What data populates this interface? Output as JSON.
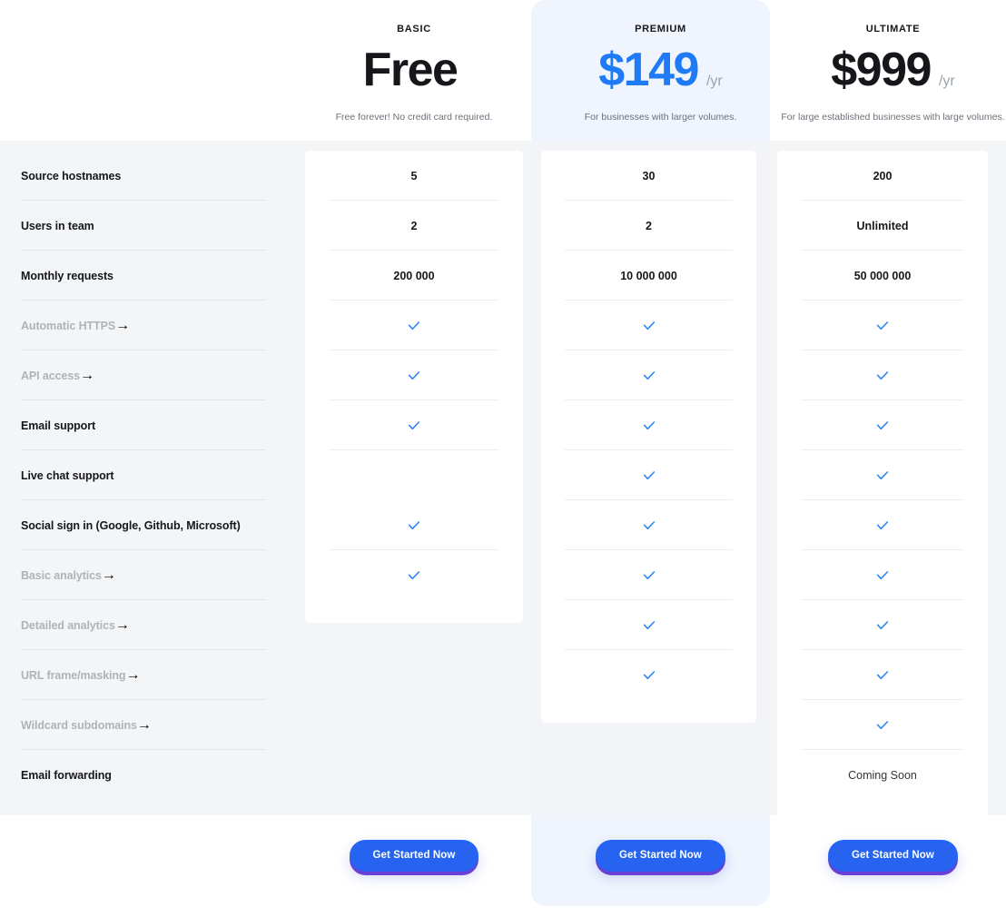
{
  "plans": [
    {
      "id": "basic",
      "name": "BASIC",
      "price": "Free",
      "period": "",
      "description": "Free forever! No credit card required.",
      "cta": "Get Started Now",
      "accent": false
    },
    {
      "id": "premium",
      "name": "PREMIUM",
      "price": "$149",
      "period": "/yr",
      "description": "For businesses with larger volumes.",
      "cta": "Get Started Now",
      "accent": true
    },
    {
      "id": "ultimate",
      "name": "ULTIMATE",
      "price": "$999",
      "period": "/yr",
      "description": "For large established businesses with large volumes.",
      "cta": "Get Started Now",
      "accent": false
    }
  ],
  "features": [
    {
      "label": "Source hostnames",
      "muted": false,
      "link": false,
      "basic": "5",
      "premium": "30",
      "ultimate": "200"
    },
    {
      "label": "Users in team",
      "muted": false,
      "link": false,
      "basic": "2",
      "premium": "2",
      "ultimate": "Unlimited"
    },
    {
      "label": "Monthly requests",
      "muted": false,
      "link": false,
      "basic": "200 000",
      "premium": "10 000 000",
      "ultimate": "50 000 000"
    },
    {
      "label": "Automatic HTTPS",
      "muted": true,
      "link": true,
      "basic": "check",
      "premium": "check",
      "ultimate": "check"
    },
    {
      "label": "API access",
      "muted": true,
      "link": true,
      "basic": "check",
      "premium": "check",
      "ultimate": "check"
    },
    {
      "label": "Email support",
      "muted": false,
      "link": false,
      "basic": "check",
      "premium": "check",
      "ultimate": "check"
    },
    {
      "label": "Live chat support",
      "muted": false,
      "link": false,
      "basic": "",
      "premium": "check",
      "ultimate": "check"
    },
    {
      "label": "Social sign in (Google, Github, Microsoft)",
      "muted": false,
      "link": false,
      "basic": "check",
      "premium": "check",
      "ultimate": "check"
    },
    {
      "label": "Basic analytics",
      "muted": true,
      "link": true,
      "basic": "check",
      "premium": "check",
      "ultimate": "check"
    },
    {
      "label": "Detailed analytics",
      "muted": true,
      "link": true,
      "basic": "",
      "premium": "check",
      "ultimate": "check"
    },
    {
      "label": "URL frame/masking",
      "muted": true,
      "link": true,
      "basic": "",
      "premium": "check",
      "ultimate": "check"
    },
    {
      "label": "Wildcard subdomains",
      "muted": true,
      "link": true,
      "basic": "",
      "premium": "",
      "ultimate": "check"
    },
    {
      "label": "Email forwarding",
      "muted": false,
      "link": false,
      "basic": "",
      "premium": "",
      "ultimate": "Coming Soon"
    }
  ],
  "icons": {
    "link_arrow": "→",
    "check": "check-icon"
  },
  "colors": {
    "accent_blue": "#1e7bf5",
    "check_blue": "#2f86f0",
    "cta_blue": "#2563f0",
    "cta_shadow_purple": "#6a3fd4",
    "premium_band": "#eff4fd",
    "gray_band": "#f4f5f6",
    "text_dark": "#15171a",
    "text_muted": "#aeb3b9"
  }
}
